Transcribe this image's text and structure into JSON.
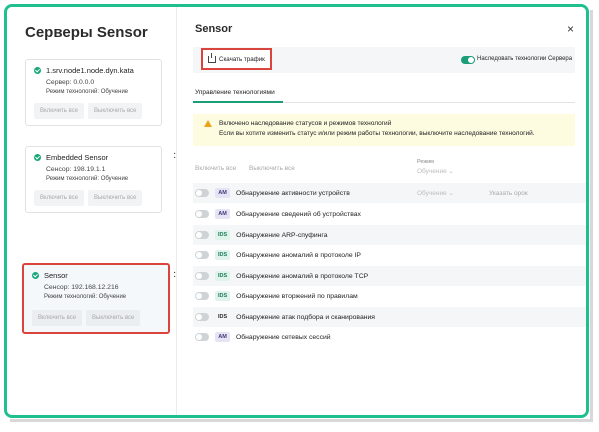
{
  "left": {
    "title": "Серверы Sensor",
    "cards": [
      {
        "name": "1.srv.node1.node.dyn.kata",
        "address": "Сервер: 0.0.0.0",
        "mode": "Режим технологий: Обучение",
        "enable_all": "Включить все",
        "disable_all": "Выключить все"
      },
      {
        "name": "Embedded Sensor",
        "address": "Сенсор: 198.19.1.1",
        "mode": "Режим технологий: Обучение",
        "enable_all": "Включить все",
        "disable_all": "Выключить все"
      },
      {
        "name": "Sensor",
        "address": "Сенсор: 192.168.12.216",
        "mode": "Режим технологий: Обучение",
        "enable_all": "Включить все",
        "disable_all": "Выключить все"
      }
    ]
  },
  "panel": {
    "title": "Sensor",
    "close": "×",
    "download_label": "Скачать трафик",
    "inherit_label": "Наследовать технологии Сервера",
    "tab": "Управление технологиями",
    "alert_title": "Включено наследование статусов и режимов технологий",
    "alert_text": "Если вы хотите изменить статус и/или режим работы технологии, выключите наследование технологий.",
    "enable_all": "Включить все",
    "disable_all": "Выключить все",
    "mode_header": "Режим",
    "mode_value": "Обучение ⌄",
    "row_mode": "Обучение ⌄",
    "row_port": "Указать орок",
    "tech": [
      {
        "badge": "AM",
        "label": "Обнаружение активности устройств"
      },
      {
        "badge": "AM",
        "label": "Обнаружение сведений об устройствах"
      },
      {
        "badge": "IDS",
        "label": "Обнаружение ARP-спуфинга"
      },
      {
        "badge": "IDS",
        "label": "Обнаружение аномалий в протоколе IP"
      },
      {
        "badge": "IDS",
        "label": "Обнаружение аномалий в протоколе TCP"
      },
      {
        "badge": "IDS",
        "label": "Обнаружение вторжений по правилам"
      },
      {
        "badge": "IDS",
        "label": "Обнаружение атак подбора и сканирования"
      },
      {
        "badge": "AM",
        "label": "Обнаружение сетевых сессий"
      }
    ]
  },
  "colors": {
    "frame": "#1fbf8f",
    "accent": "#1a9e7a",
    "highlight": "#d9453d",
    "alert_bg": "#fdfbe0"
  }
}
